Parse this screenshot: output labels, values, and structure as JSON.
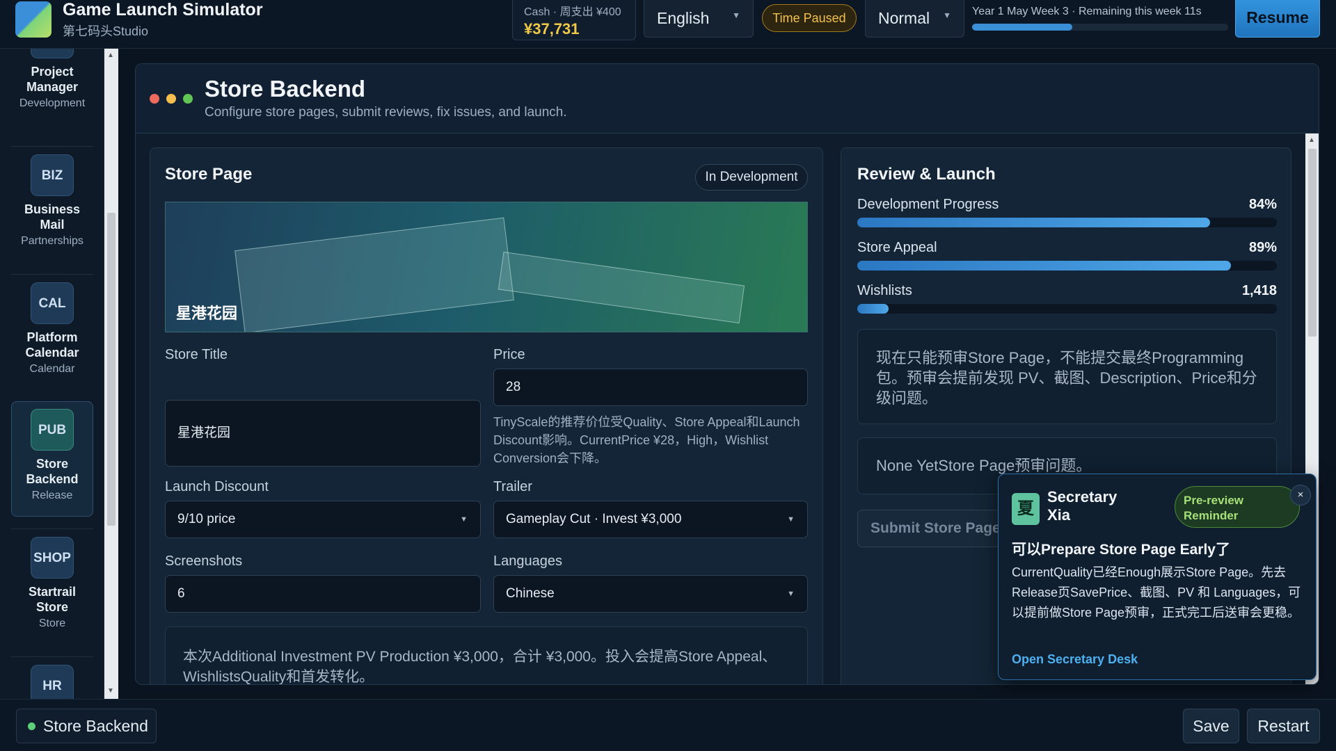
{
  "app": {
    "title": "Game Launch Simulator",
    "studio": "第七码头Studio"
  },
  "header": {
    "cash_label": "Cash · 周支出 ¥400",
    "cash_value": "¥37,731",
    "language": "English",
    "time_status": "Time Paused",
    "speed": "Normal",
    "week_text": "Year 1 May Week 3 · Remaining this week 11s",
    "week_progress": 0.39,
    "resume_label": "Resume"
  },
  "sidebar": {
    "items": [
      {
        "badge": "",
        "name": "Project Manager",
        "category": "Development"
      },
      {
        "badge": "BIZ",
        "name": "Business Mail",
        "category": "Partnerships"
      },
      {
        "badge": "CAL",
        "name": "Platform Calendar",
        "category": "Calendar"
      },
      {
        "badge": "PUB",
        "name": "Store Backend",
        "category": "Release"
      },
      {
        "badge": "SHOP",
        "name": "Startrail Store",
        "category": "Store"
      },
      {
        "badge": "HR",
        "name": "",
        "category": ""
      }
    ]
  },
  "panel": {
    "title": "Store Backend",
    "subtitle": "Configure store pages, submit reviews, fix issues, and launch."
  },
  "store_page": {
    "title": "Store Page",
    "status": "In Development",
    "banner_title": "星港花园",
    "store_title_label": "Store Title",
    "store_title_value": "星港花园",
    "price_label": "Price",
    "price_value": "28",
    "price_hint": "TinyScale的推荐价位受Quality、Store Appeal和Launch Discount影响。CurrentPrice ¥28，High，Wishlist Conversion会下降。",
    "discount_label": "Launch Discount",
    "discount_value": "9/10 price",
    "trailer_label": "Trailer",
    "trailer_value": "Gameplay Cut · Invest ¥3,000",
    "screenshots_label": "Screenshots",
    "screenshots_value": "6",
    "languages_label": "Languages",
    "languages_value": "Chinese",
    "investment_note": "本次Additional Investment PV Production ¥3,000，合计 ¥3,000。投入会提高Store Appeal、WishlistsQuality和首发转化。"
  },
  "review": {
    "title": "Review & Launch",
    "metrics": [
      {
        "label": "Development Progress",
        "value": "84%",
        "fraction": 0.84
      },
      {
        "label": "Store Appeal",
        "value": "89%",
        "fraction": 0.89
      },
      {
        "label": "Wishlists",
        "value": "1,418",
        "fraction": 0.075
      }
    ],
    "info_text": "现在只能预审Store Page，不能提交最终Programming包。预审会提前发现 PV、截图、Description、Price和分级问题。",
    "issues_text": "None YetStore Page预审问题。",
    "submit_label": "Submit Store Page"
  },
  "secretary": {
    "avatar": "夏",
    "name": "Secretary Xia",
    "badge": "Pre-review Reminder",
    "close": "×",
    "heading": "可以Prepare Store Page Early了",
    "body": "CurrentQuality已经Enough展示Store Page。先去Release页SavePrice、截图、PV 和 Languages，可以提前做Store Page预审，正式完工后送审会更稳。",
    "link": "Open Secretary Desk"
  },
  "footer": {
    "current_page": "Store Backend",
    "save_label": "Save",
    "restart_label": "Restart"
  },
  "colors": {
    "accent": "#3b8fd6",
    "cash": "#f0c94a",
    "paused": "#f2c14e",
    "online": "#5fd07a",
    "link": "#4fb0f0"
  }
}
